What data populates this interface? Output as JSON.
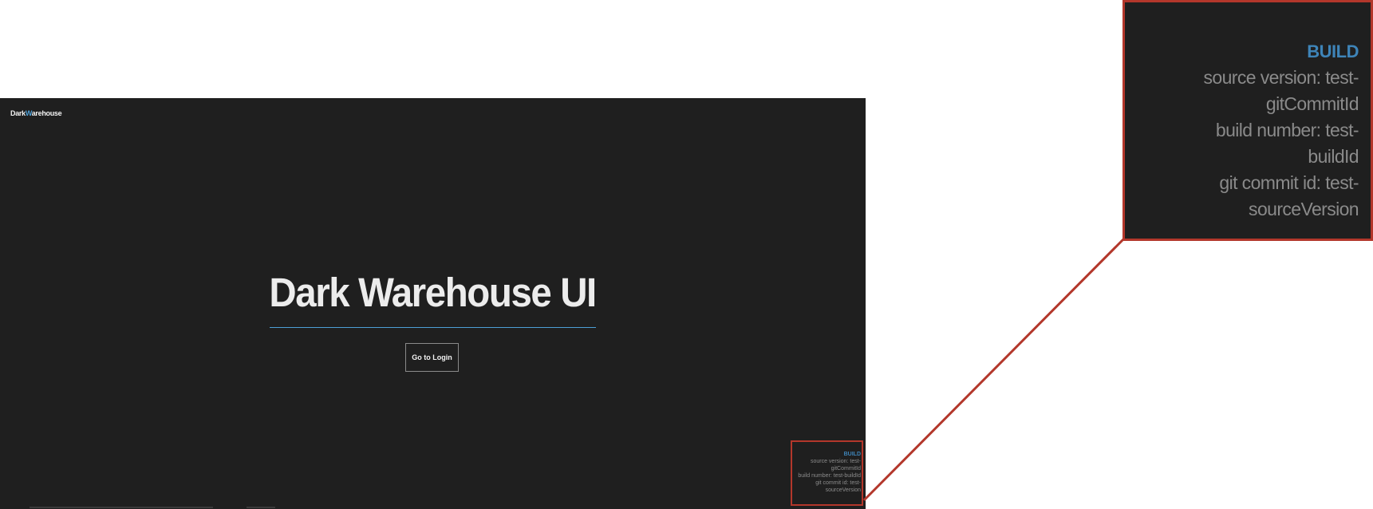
{
  "app": {
    "brand_prefix": "Dark",
    "brand_accent": "W",
    "brand_suffix": "arehouse",
    "hero_title": "Dark Warehouse UI",
    "login_button_label": "Go to Login"
  },
  "build": {
    "title": "BUILD",
    "source_version": "source version: test-gitCommitId",
    "build_number": "build number: test-buildId",
    "git_commit_id": "git commit id: test-sourceVersion"
  },
  "zoom": {
    "title": "BUILD",
    "lines": [
      "source version: test-",
      "gitCommitId",
      "build number: test-",
      "buildId",
      "git commit id: test-",
      "sourceVersion"
    ]
  },
  "colors": {
    "background": "#1f1f1f",
    "accent": "#4d9fd6",
    "highlight": "#b3372b",
    "build_title": "#3e84b8"
  }
}
